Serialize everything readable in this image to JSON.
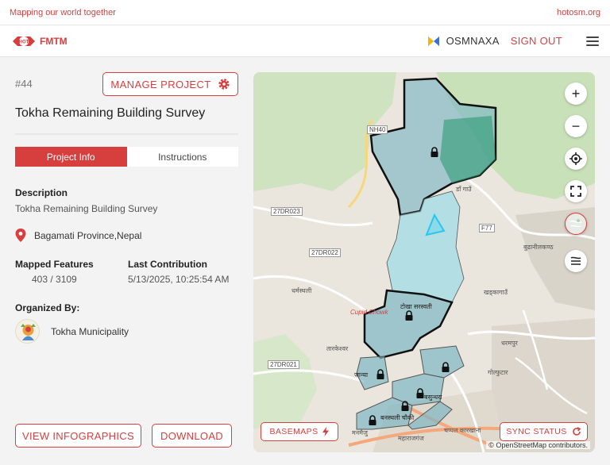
{
  "topbar": {
    "tagline": "Mapping our world together",
    "site": "hotosm.org"
  },
  "header": {
    "logo_badge": "HOT",
    "logo_text": "FMTM",
    "username": "OSMNAXA",
    "signout": "SIGN OUT"
  },
  "project": {
    "id": "#44",
    "manage_label": "MANAGE PROJECT",
    "title": "Tokha Remaining Building Survey",
    "tabs": [
      {
        "label": "Project Info",
        "active": true
      },
      {
        "label": "Instructions",
        "active": false
      }
    ],
    "description_label": "Description",
    "description": "Tokha Remaining Building Survey",
    "location": "Bagamati Province,Nepal",
    "mapped_features_label": "Mapped Features",
    "mapped_features": "403 / 3109",
    "last_contribution_label": "Last Contribution",
    "last_contribution": "5/13/2025, 10:25:54 AM",
    "organized_by_label": "Organized By:",
    "organization": "Tokha Municipality",
    "view_infographics": "VIEW INFOGRAPHICS",
    "download": "DOWNLOAD"
  },
  "map": {
    "basemaps_label": "BASEMAPS",
    "sync_label": "SYNC STATUS",
    "attribution": "© OpenStreetMap contributors.",
    "road_labels": [
      "NH40",
      "27DR023",
      "27DR022",
      "27DR021",
      "F77"
    ],
    "place_labels": [
      "धर्मस्थली",
      "टोखा सरस्वती",
      "Cupid Chowk",
      "तारकेश्वर",
      "जान्या",
      "बुढानीलकण्ठ",
      "खड्कागाउँ",
      "धरमपुर",
      "गोल्फुटार",
      "बनस्थली चौकी",
      "महाराजगंज",
      "चप्पल कारखाना",
      "मनमैजु",
      "बसुन्धरा",
      "डाँ गाउँ"
    ],
    "accent": "#d73f3f"
  }
}
